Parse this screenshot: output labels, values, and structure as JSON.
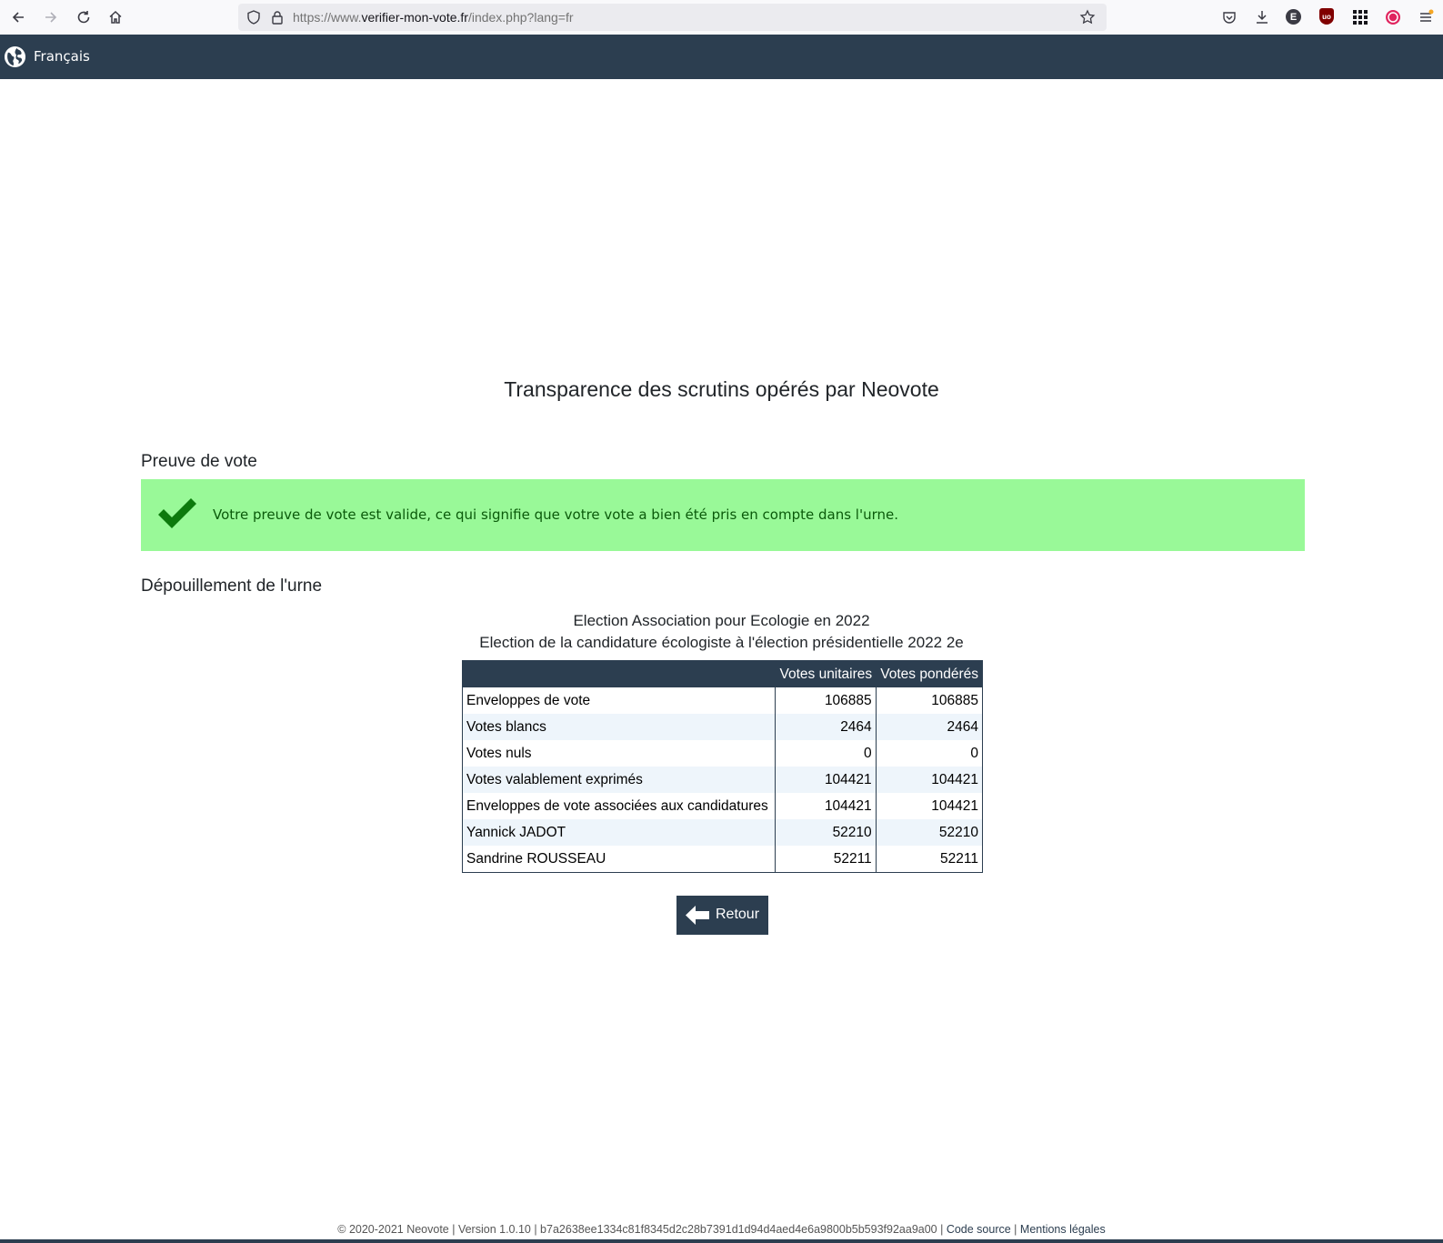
{
  "browser": {
    "url_prefix": "https://www.",
    "url_domain": "verifier-mon-vote.fr",
    "url_path": "/index.php?lang=fr",
    "ext_e_label": "E",
    "ext_ublock_label": "uo"
  },
  "nav": {
    "language": "Français"
  },
  "page": {
    "title": "Transparence des scrutins opérés par Neovote"
  },
  "proof": {
    "heading": "Preuve de vote",
    "message": "Votre preuve de vote est valide, ce qui signifie que votre vote a bien été pris en compte dans l'urne.",
    "status_color": "#99f998"
  },
  "tally": {
    "heading": "Dépouillement de l'urne",
    "election_line1": "Election Association pour Ecologie en 2022",
    "election_line2": "Election de la candidature écologiste à l'élection présidentielle 2022 2e",
    "columns": [
      "",
      "Votes unitaires",
      "Votes pondérés"
    ],
    "rows": [
      {
        "label": "Enveloppes de vote",
        "unit": "106885",
        "weighted": "106885"
      },
      {
        "label": "Votes blancs",
        "unit": "2464",
        "weighted": "2464"
      },
      {
        "label": "Votes nuls",
        "unit": "0",
        "weighted": "0"
      },
      {
        "label": "Votes valablement exprimés",
        "unit": "104421",
        "weighted": "104421"
      },
      {
        "label": "Enveloppes de vote associées aux candidatures",
        "unit": "104421",
        "weighted": "104421"
      },
      {
        "label": "Yannick JADOT",
        "unit": "52210",
        "weighted": "52210"
      },
      {
        "label": "Sandrine ROUSSEAU",
        "unit": "52211",
        "weighted": "52211"
      }
    ]
  },
  "actions": {
    "back_label": "Retour"
  },
  "footer": {
    "text": "© 2020-2021 Neovote | Version 1.0.10 | b7a2638ee1334c81f8345d2c28b7391d1d94d4aed4e6a9800b5b593f92aa9a00 | ",
    "code_source": "Code source",
    "separator": " | ",
    "legal": "Mentions légales"
  },
  "colors": {
    "navbar": "#2c3e50",
    "success_text": "#0a5a0a",
    "check": "#0d7a0d"
  }
}
